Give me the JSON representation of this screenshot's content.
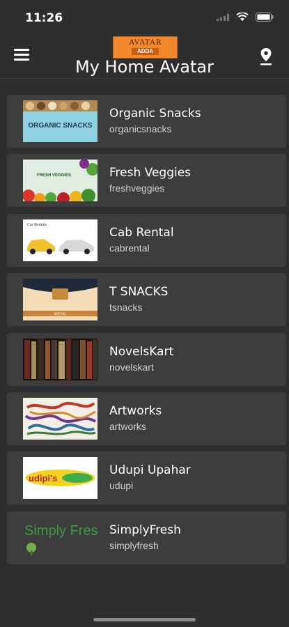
{
  "status_bar": {
    "time": "11:26"
  },
  "header": {
    "logo_line1": "AVATAR",
    "logo_line2": "ADDA",
    "title": "My Home Avatar",
    "accent": "#f0892e"
  },
  "items": [
    {
      "title": "Organic Snacks",
      "subtitle": "organicsnacks",
      "thumb_text": "ORGANIC SNACKS"
    },
    {
      "title": "Fresh Veggies",
      "subtitle": "freshveggies",
      "thumb_text": "FRESH VEGGIES"
    },
    {
      "title": "Cab Rental",
      "subtitle": "cabrental",
      "thumb_text": "Car Rentals"
    },
    {
      "title": "T SNACKS",
      "subtitle": "tsnacks",
      "thumb_text": "MENU"
    },
    {
      "title": "NovelsKart",
      "subtitle": "novelskart"
    },
    {
      "title": "Artworks",
      "subtitle": "artworks"
    },
    {
      "title": "Udupi Upahar",
      "subtitle": "udupi",
      "thumb_text": "udipi's"
    },
    {
      "title": "SimplyFresh",
      "subtitle": "simplyfresh",
      "thumb_text": "Simply Fresh"
    }
  ]
}
